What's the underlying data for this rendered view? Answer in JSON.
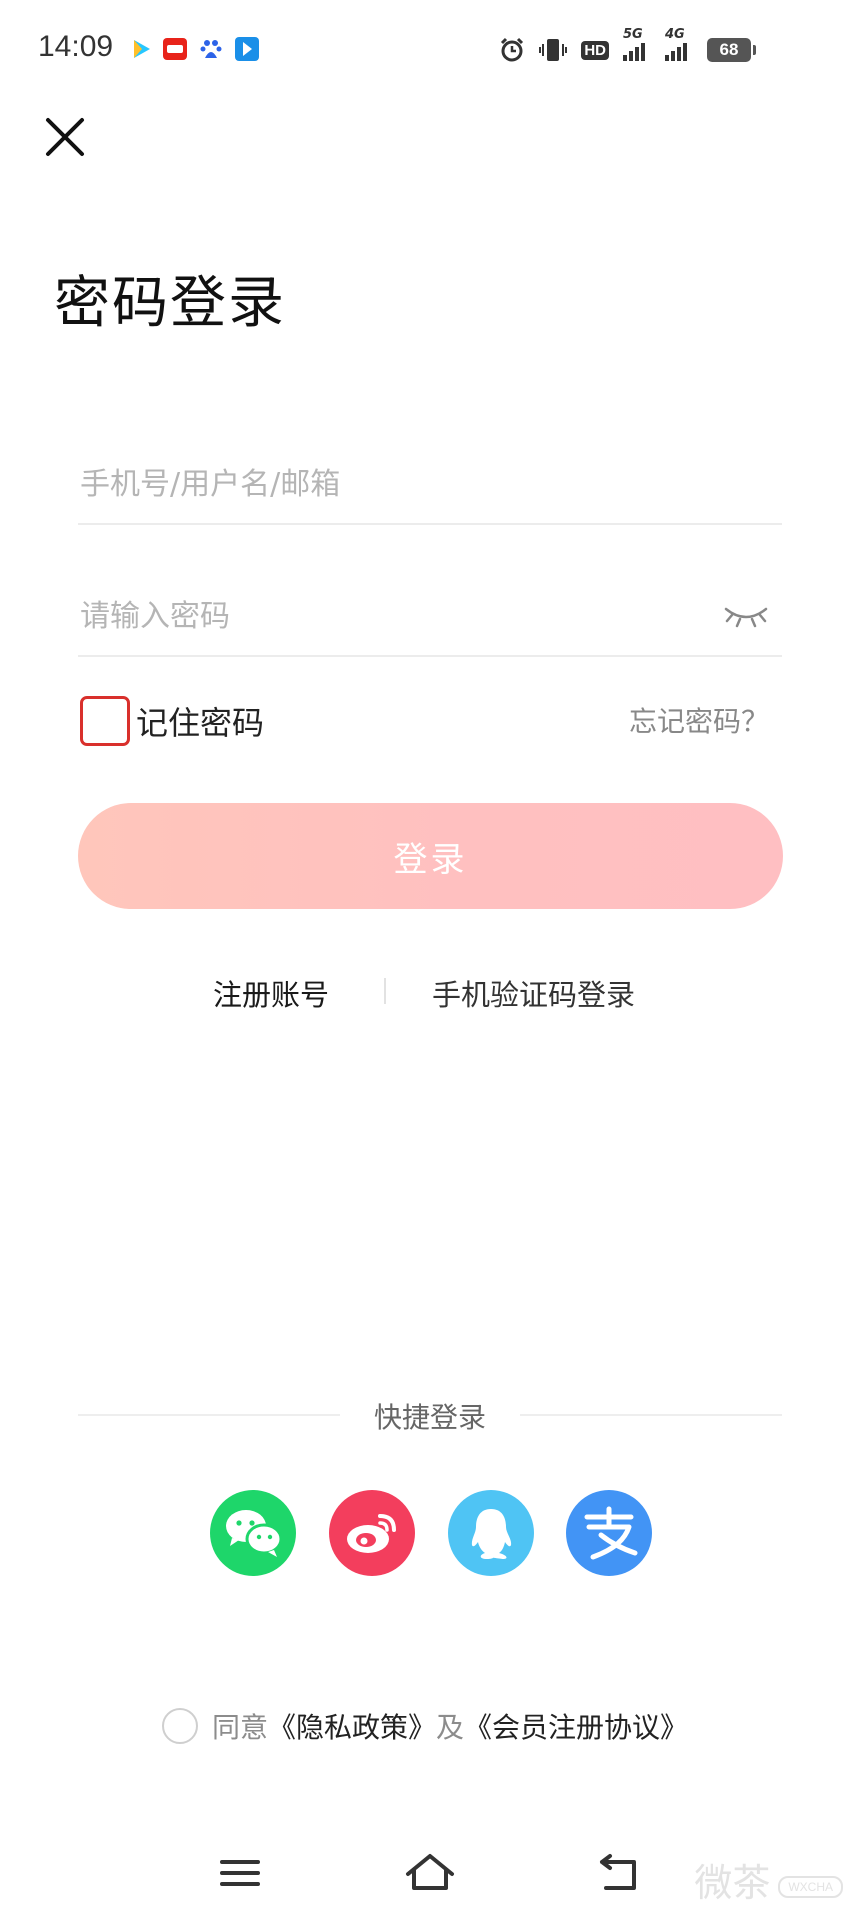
{
  "status_bar": {
    "time": "14:09",
    "app_icons": [
      "video-app-icon",
      "store-app-icon",
      "baidu-app-icon",
      "share-app-icon"
    ],
    "indicators": [
      "alarm-icon",
      "vibrate-icon",
      "hd-icon"
    ],
    "hd_label": "HD",
    "signal_5g": "5G",
    "signal_4g": "4G",
    "battery": "68"
  },
  "header": {
    "close_icon": "close-icon",
    "title": "密码登录"
  },
  "form": {
    "account_placeholder": "手机号/用户名/邮箱",
    "account_value": "",
    "password_placeholder": "请输入密码",
    "password_value": "",
    "password_toggle_icon": "eye-closed-icon",
    "remember_label": "记住密码",
    "remember_checked": false,
    "forgot_label": "忘记密码？",
    "login_label": "登录"
  },
  "links": {
    "register": "注册账号",
    "sms_login": "手机验证码登录"
  },
  "quick_login": {
    "title": "快捷登录",
    "providers": [
      {
        "icon": "wechat-icon",
        "color": "#1ed66a"
      },
      {
        "icon": "weibo-icon",
        "color": "#f33e5d"
      },
      {
        "icon": "qq-icon",
        "color": "#4fc4f4"
      },
      {
        "icon": "alipay-icon",
        "color": "#4294f5"
      }
    ]
  },
  "agreement": {
    "agree": "同意",
    "privacy": "《隐私政策》",
    "and": "及",
    "member": "《会员注册协议》",
    "checked": false
  },
  "nav": {
    "menu_icon": "menu-icon",
    "home_icon": "home-icon",
    "back_icon": "back-icon"
  },
  "watermark": {
    "text": "微茶",
    "sub": "WXCHA"
  },
  "colors": {
    "accent_red": "#d9302c",
    "login_button": "#ffc2bd"
  }
}
